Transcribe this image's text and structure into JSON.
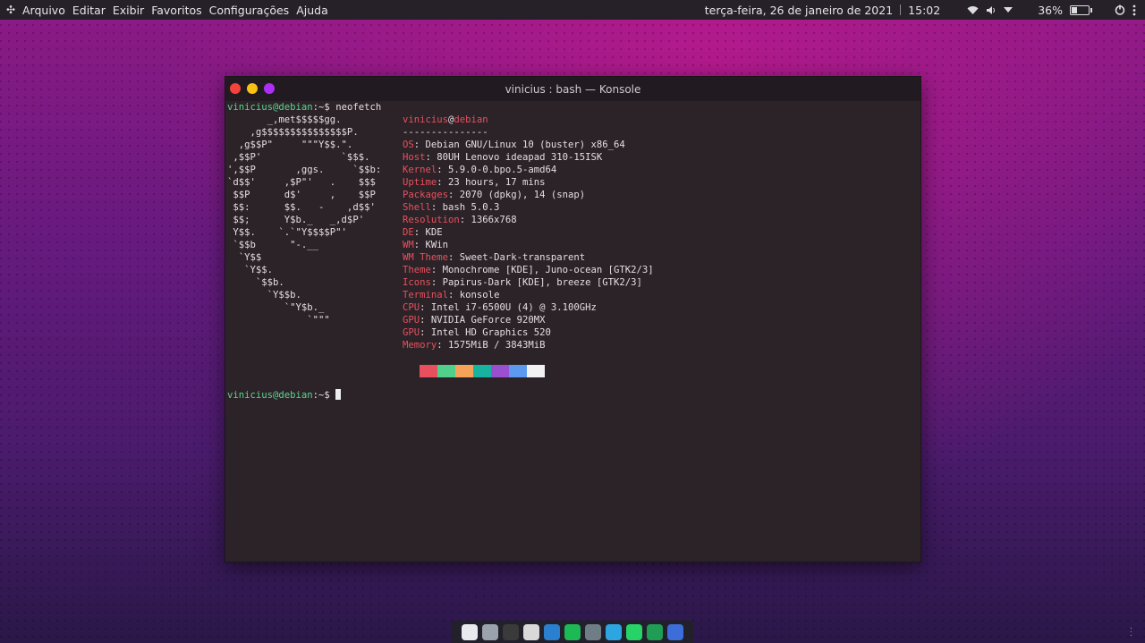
{
  "topbar": {
    "menu": [
      "Arquivo",
      "Editar",
      "Exibir",
      "Favoritos",
      "Configurações",
      "Ajuda"
    ],
    "datetime": "terça-feira, 26 de janeiro de 2021",
    "time": "15:02",
    "battery_percent": "36%",
    "battery_level": 0.36
  },
  "window": {
    "title": "vinicius : bash — Konsole"
  },
  "terminal": {
    "prompt": "vinicius@debian",
    "prompt_suffix": ":~$ ",
    "command": "neofetch",
    "ascii": "       _,met$$$$$gg.\n    ,g$$$$$$$$$$$$$$$P.\n  ,g$$P\"     \"\"\"Y$$.\".\n ,$$P'              `$$$.\n',$$P       ,ggs.     `$$b:\n`d$$'     ,$P\"'   .    $$$\n $$P      d$'     ,    $$P\n $$:      $$.   -    ,d$$'\n $$;      Y$b._   _,d$P'\n Y$$.    `.`\"Y$$$$P\"'\n `$$b      \"-.__\n  `Y$$\n   `Y$$.\n     `$$b.\n       `Y$$b.\n          `\"Y$b._\n              `\"\"\"",
    "user": "vinicius",
    "at": "@",
    "host": "debian",
    "underline": "---------------",
    "info": [
      {
        "key": "OS",
        "value": "Debian GNU/Linux 10 (buster) x86_64"
      },
      {
        "key": "Host",
        "value": "80UH Lenovo ideapad 310-15ISK"
      },
      {
        "key": "Kernel",
        "value": "5.9.0-0.bpo.5-amd64"
      },
      {
        "key": "Uptime",
        "value": "23 hours, 17 mins"
      },
      {
        "key": "Packages",
        "value": "2070 (dpkg), 14 (snap)"
      },
      {
        "key": "Shell",
        "value": "bash 5.0.3"
      },
      {
        "key": "Resolution",
        "value": "1366x768"
      },
      {
        "key": "DE",
        "value": "KDE"
      },
      {
        "key": "WM",
        "value": "KWin"
      },
      {
        "key": "WM Theme",
        "value": "Sweet-Dark-transparent"
      },
      {
        "key": "Theme",
        "value": "Monochrome [KDE], Juno-ocean [GTK2/3]"
      },
      {
        "key": "Icons",
        "value": "Papirus-Dark [KDE], breeze [GTK2/3]"
      },
      {
        "key": "Terminal",
        "value": "konsole"
      },
      {
        "key": "CPU",
        "value": "Intel i7-6500U (4) @ 3.100GHz"
      },
      {
        "key": "GPU",
        "value": "NVIDIA GeForce 920MX"
      },
      {
        "key": "GPU",
        "value": "Intel HD Graphics 520"
      },
      {
        "key": "Memory",
        "value": "1575MiB / 3843MiB"
      }
    ],
    "palette": [
      "#e8505d",
      "#4fd18b",
      "#f6a359",
      "#17b3a0",
      "#9a4fcf",
      "#5b9af0",
      "#f2f2f2"
    ]
  },
  "dock": {
    "apps": [
      {
        "icon": "chrome-icon",
        "color": "#e8eaed"
      },
      {
        "icon": "files-icon",
        "color": "#9aa3ad"
      },
      {
        "icon": "terminal-icon",
        "color": "#3a3a3a"
      },
      {
        "icon": "software-store-icon",
        "color": "#d9d9d9"
      },
      {
        "icon": "vscode-icon",
        "color": "#2a7fcf"
      },
      {
        "icon": "spotify-icon",
        "color": "#1db954"
      },
      {
        "icon": "calculator-icon",
        "color": "#6f7d86"
      },
      {
        "icon": "telegram-icon",
        "color": "#2da5e0"
      },
      {
        "icon": "whatsapp-icon",
        "color": "#25d366"
      },
      {
        "icon": "spreadsheet-icon",
        "color": "#1f9d55"
      },
      {
        "icon": "document-icon",
        "color": "#3d6dd8"
      }
    ]
  }
}
